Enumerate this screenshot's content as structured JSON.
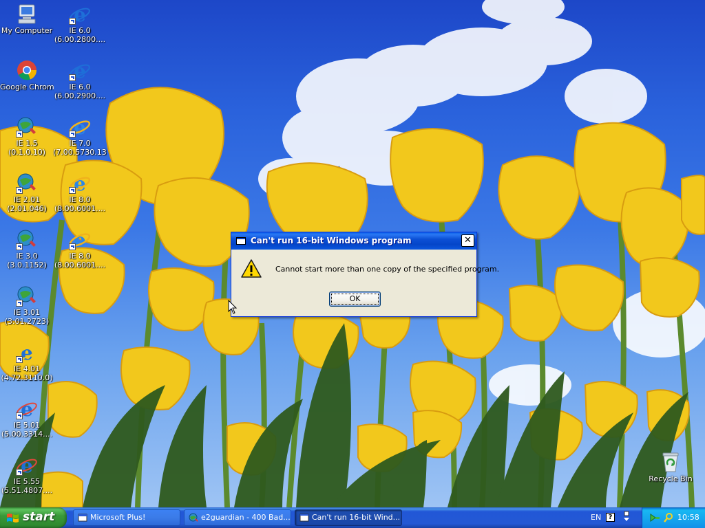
{
  "desktop": {
    "icons": [
      {
        "id": "my-computer",
        "label": "My Computer",
        "kind": "computer"
      },
      {
        "id": "ie6-2800",
        "label": "IE 6.0\n(6.00.2800....",
        "kind": "ie"
      },
      {
        "id": "google-chrome",
        "label": "Google Chrome",
        "kind": "chrome"
      },
      {
        "id": "ie6-2900",
        "label": "IE 6.0\n(6.00.2900....",
        "kind": "ie"
      },
      {
        "id": "ie15",
        "label": "IE 1.5\n(0.1.0.10)",
        "kind": "ie-old"
      },
      {
        "id": "ie7",
        "label": "IE 7.0\n(7.00.5730.13)",
        "kind": "ie7"
      },
      {
        "id": "ie201",
        "label": "IE 2.01\n(2.01.046)",
        "kind": "ie-old"
      },
      {
        "id": "ie8-a",
        "label": "IE 8.0\n(8.00.6001....",
        "kind": "ie7"
      },
      {
        "id": "ie30",
        "label": "IE 3.0\n(3.0.1152)",
        "kind": "ie-old"
      },
      {
        "id": "ie8-b",
        "label": "IE 8.0\n(8.00.6001....",
        "kind": "ie7"
      },
      {
        "id": "ie301",
        "label": "IE 3.01\n(3.01.2723)",
        "kind": "ie-old"
      },
      {
        "id": "ie401",
        "label": "IE 4.01\n(4.72.3110.0)",
        "kind": "ie"
      },
      {
        "id": "ie501",
        "label": "IE 5.01\n(5.00.3314....",
        "kind": "ie"
      },
      {
        "id": "ie555",
        "label": "IE 5.55\n(5.51.4807....",
        "kind": "ie"
      },
      {
        "id": "recycle-bin",
        "label": "Recycle Bin",
        "kind": "recycle"
      }
    ]
  },
  "dialog": {
    "title": "Can't run 16-bit Windows program",
    "close_glyph": "✕",
    "message": "Cannot start more than one copy of the specified program.",
    "ok_label": "OK"
  },
  "taskbar": {
    "start_label": "start",
    "tasks": [
      {
        "label": "Microsoft Plus!",
        "active": false
      },
      {
        "label": "e2guardian - 400 Bad...",
        "active": false
      },
      {
        "label": "Can't run 16-bit Wind...",
        "active": true
      }
    ],
    "language": "EN",
    "help_glyph": "?",
    "clock": "10:58"
  },
  "colors": {
    "titlebar_blue": "#0446c8",
    "dialog_face": "#ece9d8",
    "taskbar_blue": "#2458d4",
    "start_green": "#3a9a3a",
    "tray_blue": "#139beb",
    "tulip_yellow": "#f2c81c"
  }
}
